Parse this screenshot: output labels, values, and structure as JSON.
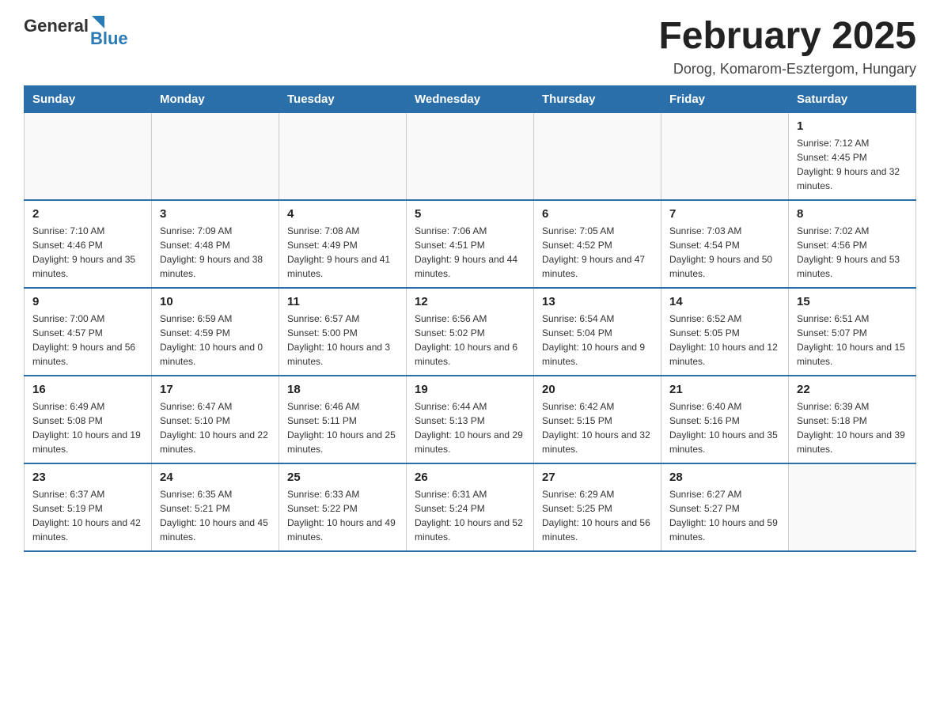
{
  "header": {
    "logo": {
      "general": "General",
      "blue": "Blue"
    },
    "title": "February 2025",
    "location": "Dorog, Komarom-Esztergom, Hungary"
  },
  "days_of_week": [
    "Sunday",
    "Monday",
    "Tuesday",
    "Wednesday",
    "Thursday",
    "Friday",
    "Saturday"
  ],
  "weeks": [
    [
      {
        "day": "",
        "info": ""
      },
      {
        "day": "",
        "info": ""
      },
      {
        "day": "",
        "info": ""
      },
      {
        "day": "",
        "info": ""
      },
      {
        "day": "",
        "info": ""
      },
      {
        "day": "",
        "info": ""
      },
      {
        "day": "1",
        "info": "Sunrise: 7:12 AM\nSunset: 4:45 PM\nDaylight: 9 hours and 32 minutes."
      }
    ],
    [
      {
        "day": "2",
        "info": "Sunrise: 7:10 AM\nSunset: 4:46 PM\nDaylight: 9 hours and 35 minutes."
      },
      {
        "day": "3",
        "info": "Sunrise: 7:09 AM\nSunset: 4:48 PM\nDaylight: 9 hours and 38 minutes."
      },
      {
        "day": "4",
        "info": "Sunrise: 7:08 AM\nSunset: 4:49 PM\nDaylight: 9 hours and 41 minutes."
      },
      {
        "day": "5",
        "info": "Sunrise: 7:06 AM\nSunset: 4:51 PM\nDaylight: 9 hours and 44 minutes."
      },
      {
        "day": "6",
        "info": "Sunrise: 7:05 AM\nSunset: 4:52 PM\nDaylight: 9 hours and 47 minutes."
      },
      {
        "day": "7",
        "info": "Sunrise: 7:03 AM\nSunset: 4:54 PM\nDaylight: 9 hours and 50 minutes."
      },
      {
        "day": "8",
        "info": "Sunrise: 7:02 AM\nSunset: 4:56 PM\nDaylight: 9 hours and 53 minutes."
      }
    ],
    [
      {
        "day": "9",
        "info": "Sunrise: 7:00 AM\nSunset: 4:57 PM\nDaylight: 9 hours and 56 minutes."
      },
      {
        "day": "10",
        "info": "Sunrise: 6:59 AM\nSunset: 4:59 PM\nDaylight: 10 hours and 0 minutes."
      },
      {
        "day": "11",
        "info": "Sunrise: 6:57 AM\nSunset: 5:00 PM\nDaylight: 10 hours and 3 minutes."
      },
      {
        "day": "12",
        "info": "Sunrise: 6:56 AM\nSunset: 5:02 PM\nDaylight: 10 hours and 6 minutes."
      },
      {
        "day": "13",
        "info": "Sunrise: 6:54 AM\nSunset: 5:04 PM\nDaylight: 10 hours and 9 minutes."
      },
      {
        "day": "14",
        "info": "Sunrise: 6:52 AM\nSunset: 5:05 PM\nDaylight: 10 hours and 12 minutes."
      },
      {
        "day": "15",
        "info": "Sunrise: 6:51 AM\nSunset: 5:07 PM\nDaylight: 10 hours and 15 minutes."
      }
    ],
    [
      {
        "day": "16",
        "info": "Sunrise: 6:49 AM\nSunset: 5:08 PM\nDaylight: 10 hours and 19 minutes."
      },
      {
        "day": "17",
        "info": "Sunrise: 6:47 AM\nSunset: 5:10 PM\nDaylight: 10 hours and 22 minutes."
      },
      {
        "day": "18",
        "info": "Sunrise: 6:46 AM\nSunset: 5:11 PM\nDaylight: 10 hours and 25 minutes."
      },
      {
        "day": "19",
        "info": "Sunrise: 6:44 AM\nSunset: 5:13 PM\nDaylight: 10 hours and 29 minutes."
      },
      {
        "day": "20",
        "info": "Sunrise: 6:42 AM\nSunset: 5:15 PM\nDaylight: 10 hours and 32 minutes."
      },
      {
        "day": "21",
        "info": "Sunrise: 6:40 AM\nSunset: 5:16 PM\nDaylight: 10 hours and 35 minutes."
      },
      {
        "day": "22",
        "info": "Sunrise: 6:39 AM\nSunset: 5:18 PM\nDaylight: 10 hours and 39 minutes."
      }
    ],
    [
      {
        "day": "23",
        "info": "Sunrise: 6:37 AM\nSunset: 5:19 PM\nDaylight: 10 hours and 42 minutes."
      },
      {
        "day": "24",
        "info": "Sunrise: 6:35 AM\nSunset: 5:21 PM\nDaylight: 10 hours and 45 minutes."
      },
      {
        "day": "25",
        "info": "Sunrise: 6:33 AM\nSunset: 5:22 PM\nDaylight: 10 hours and 49 minutes."
      },
      {
        "day": "26",
        "info": "Sunrise: 6:31 AM\nSunset: 5:24 PM\nDaylight: 10 hours and 52 minutes."
      },
      {
        "day": "27",
        "info": "Sunrise: 6:29 AM\nSunset: 5:25 PM\nDaylight: 10 hours and 56 minutes."
      },
      {
        "day": "28",
        "info": "Sunrise: 6:27 AM\nSunset: 5:27 PM\nDaylight: 10 hours and 59 minutes."
      },
      {
        "day": "",
        "info": ""
      }
    ]
  ]
}
